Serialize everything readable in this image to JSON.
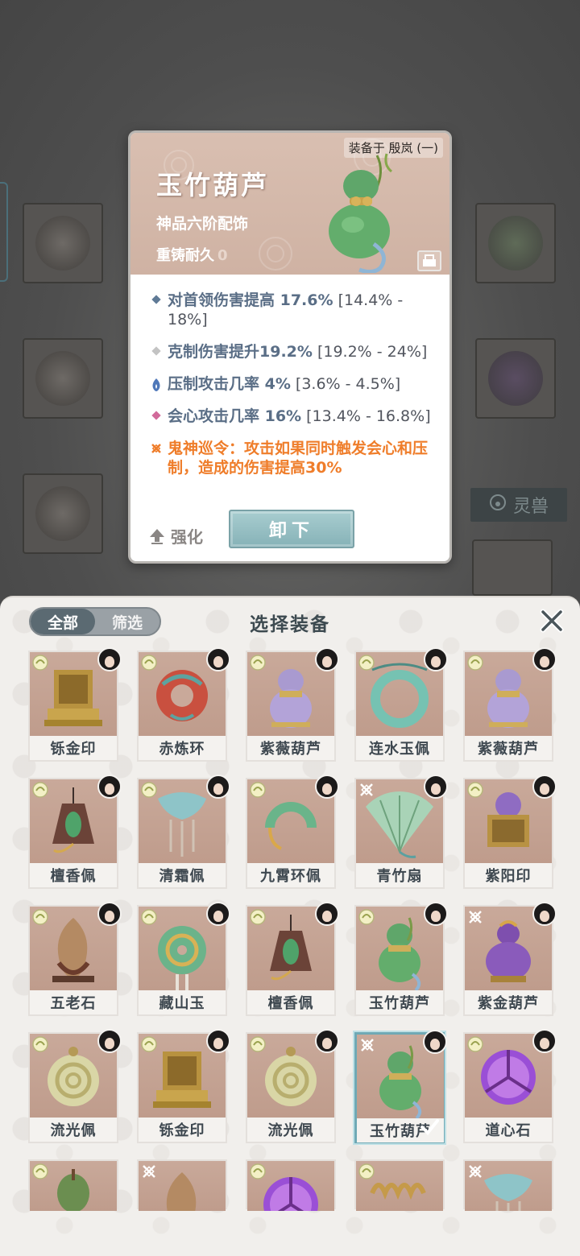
{
  "background": {
    "side_tab_label": "灵兽"
  },
  "detail": {
    "equipped_on": "装备于 殷岚 (一)",
    "name": "玉竹葫芦",
    "grade": "神品六阶配饰",
    "durability_label": "重铸耐久",
    "durability_value": "0",
    "stats": [
      {
        "bullet": "diamond-blue-icon",
        "text": "对首领伤害提高 17.6%",
        "range": " [14.4% - 18%]"
      },
      {
        "bullet": "diamond-grey-icon",
        "text": "克制伤害提升19.2%",
        "range": " [19.2% - 24%]"
      },
      {
        "bullet": "flame-blue-icon",
        "text": "压制攻击几率 4%",
        "range": " [3.6% - 4.5%]"
      },
      {
        "bullet": "diamond-pink-icon",
        "text": "会心攻击几率 16%",
        "range": " [13.4% - 16.8%]"
      }
    ],
    "special": {
      "bullet": "special-sigil-icon",
      "text": "鬼神巡令：攻击如果同时触发会心和压制，造成的伤害提高30%"
    },
    "enhance_label": "强化",
    "unequip_label": "卸下"
  },
  "panel": {
    "filter_all": "全部",
    "filter_screen": "筛选",
    "title": "选择装备",
    "items": [
      {
        "name": "铄金印",
        "art": "seal-gold"
      },
      {
        "name": "赤炼环",
        "art": "ring-red"
      },
      {
        "name": "紫薇葫芦",
        "art": "gourd-purple"
      },
      {
        "name": "连水玉佩",
        "art": "ring-jade"
      },
      {
        "name": "紫薇葫芦",
        "art": "gourd-purple"
      },
      {
        "name": "檀香佩",
        "art": "pendant-green"
      },
      {
        "name": "清霜佩",
        "art": "pendant-blue"
      },
      {
        "name": "九霄环佩",
        "art": "ring-open"
      },
      {
        "name": "青竹扇",
        "art": "fan-green"
      },
      {
        "name": "紫阳印",
        "art": "seal-purple"
      },
      {
        "name": "五老石",
        "art": "stone-brown"
      },
      {
        "name": "藏山玉",
        "art": "disc-jade"
      },
      {
        "name": "檀香佩",
        "art": "pendant-green"
      },
      {
        "name": "玉竹葫芦",
        "art": "gourd-green"
      },
      {
        "name": "紫金葫芦",
        "art": "gourd-violet"
      },
      {
        "name": "流光佩",
        "art": "disc-pale"
      },
      {
        "name": "铄金印",
        "art": "seal-gold"
      },
      {
        "name": "流光佩",
        "art": "disc-pale"
      },
      {
        "name": "玉竹葫芦",
        "art": "gourd-green",
        "selected": true
      },
      {
        "name": "道心石",
        "art": "orb-purple"
      }
    ],
    "partial_items": [
      "gourd-small",
      "stone-brown",
      "orb-purple",
      "coil-gold",
      "pendant-blue"
    ]
  }
}
